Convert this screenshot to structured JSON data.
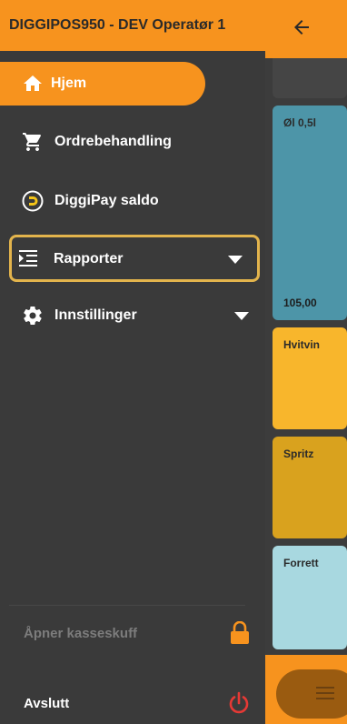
{
  "drawer": {
    "title": "DIGGIPOS950 - DEV Operatør 1",
    "items": [
      {
        "label": "Hjem",
        "icon": "home-icon"
      },
      {
        "label": "Ordrebehandling",
        "icon": "cart-icon"
      },
      {
        "label": "DiggiPay saldo",
        "icon": "diggipay-icon"
      },
      {
        "label": "Rapporter",
        "icon": "report-list-icon"
      },
      {
        "label": "Innstillinger",
        "icon": "gear-icon"
      }
    ],
    "open_drawer_label": "Åpner kasseskuff",
    "quit_label": "Avslutt"
  },
  "products": [
    {
      "name": "Øl 0,5l",
      "price": "105,00",
      "color": "#4d95a8"
    },
    {
      "name": "Hvitvin",
      "color": "#f8b62c"
    },
    {
      "name": "Spritz",
      "color": "#d9a21e"
    },
    {
      "name": "Forrett",
      "color": "#a8d8e0"
    }
  ],
  "colors": {
    "accent": "#f7931e",
    "highlight_border": "#e3b44c",
    "drawer_bg": "#3a3a3a",
    "power": "#e53935"
  }
}
